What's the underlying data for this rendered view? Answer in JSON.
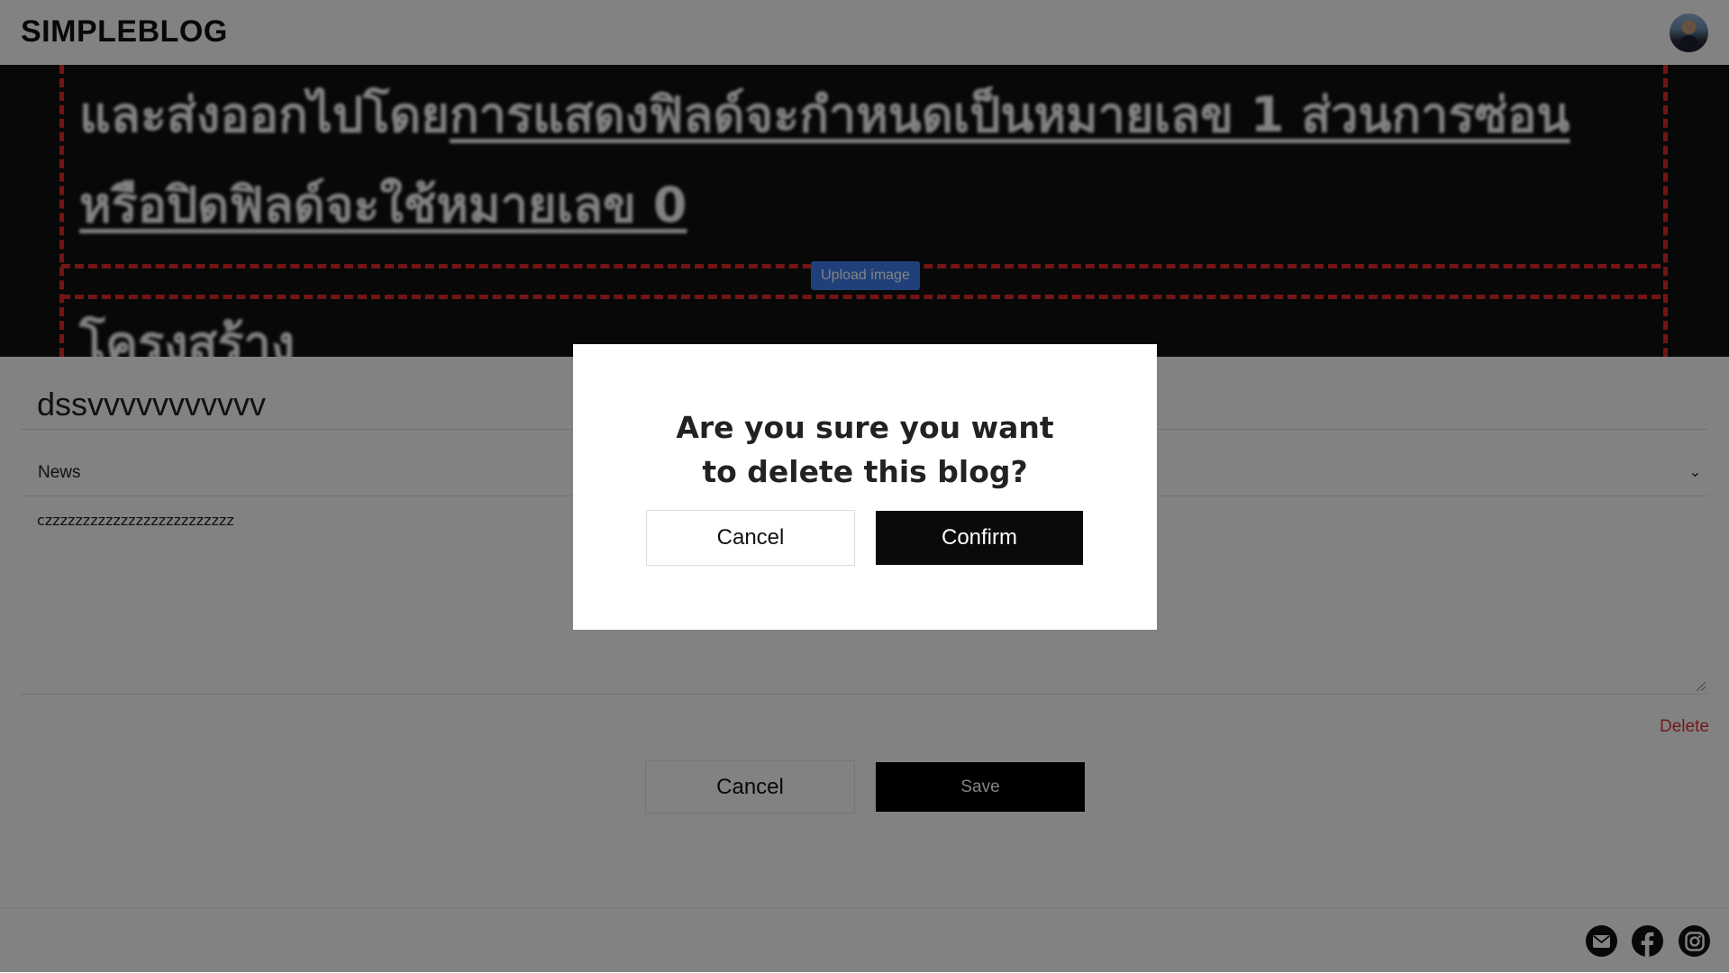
{
  "header": {
    "logo": "SIMPLEBLOG",
    "avatar_icon": "user-avatar"
  },
  "hero": {
    "image_text_line1_plain": "และส่งออกไปโดย",
    "image_text_line1_underlined": "การแสดงฟิลด์จะกำหนดเป็นหมายเลข 1 ส่วนการซ่อน",
    "image_text_line2": "หรือปิดฟิลด์จะใช้หมายเลข 0",
    "image_text_line3": "โครงสร้าง",
    "upload_label": "Upload image",
    "dash_color": "#e22a2a"
  },
  "form": {
    "title_value": "dssvvvvvvvvvvv",
    "category_value": "News",
    "content_value": "czzzzzzzzzzzzzzzzzzzzzzzzz",
    "delete_label": "Delete",
    "cancel_label": "Cancel",
    "save_label": "Save"
  },
  "footer": {
    "icons": [
      "email-icon",
      "facebook-icon",
      "instagram-icon"
    ]
  },
  "modal": {
    "title_line1": "Are you sure you want",
    "title_line2": "to delete this blog?",
    "cancel_label": "Cancel",
    "confirm_label": "Confirm"
  },
  "colors": {
    "overlay": "rgba(0,0,0,0.49)",
    "delete": "#e2323a",
    "upload": "#3d7ff0",
    "primary_button": "#000000"
  }
}
